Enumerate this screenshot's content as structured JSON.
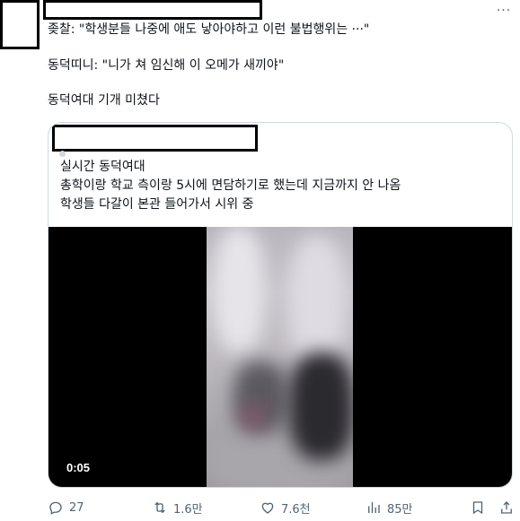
{
  "post": {
    "more_icon_glyph": "···",
    "lines": [
      "좆찰: \"학생분들 나중에 애도 낳아야하고 이런 불법행위는 ···\"",
      "동덕띠니: \"니가 쳐 임신해 이 오메가 새끼야\"",
      "동덕여대 기개 미쳤다"
    ]
  },
  "quote": {
    "lines": [
      "실시간 동덕여대",
      "총학이랑 학교 측이랑 5시에 면담하기로 했는데 지금까지 안 나옴",
      "학생들 다갈이 본관 들어가서 시위 중"
    ],
    "video": {
      "duration": "0:05"
    }
  },
  "actions": {
    "reply_count": "27",
    "retweet_count": "1.6만",
    "like_count": "7.6천",
    "views_count": "85만"
  },
  "icons": {
    "reply": "reply-icon",
    "retweet": "retweet-icon",
    "like": "heart-icon",
    "views": "analytics-icon",
    "bookmark": "bookmark-icon",
    "share": "share-icon",
    "more": "more-icon"
  },
  "colors": {
    "text": "#0f1419",
    "secondary": "#536471",
    "border": "#cfd9de"
  }
}
